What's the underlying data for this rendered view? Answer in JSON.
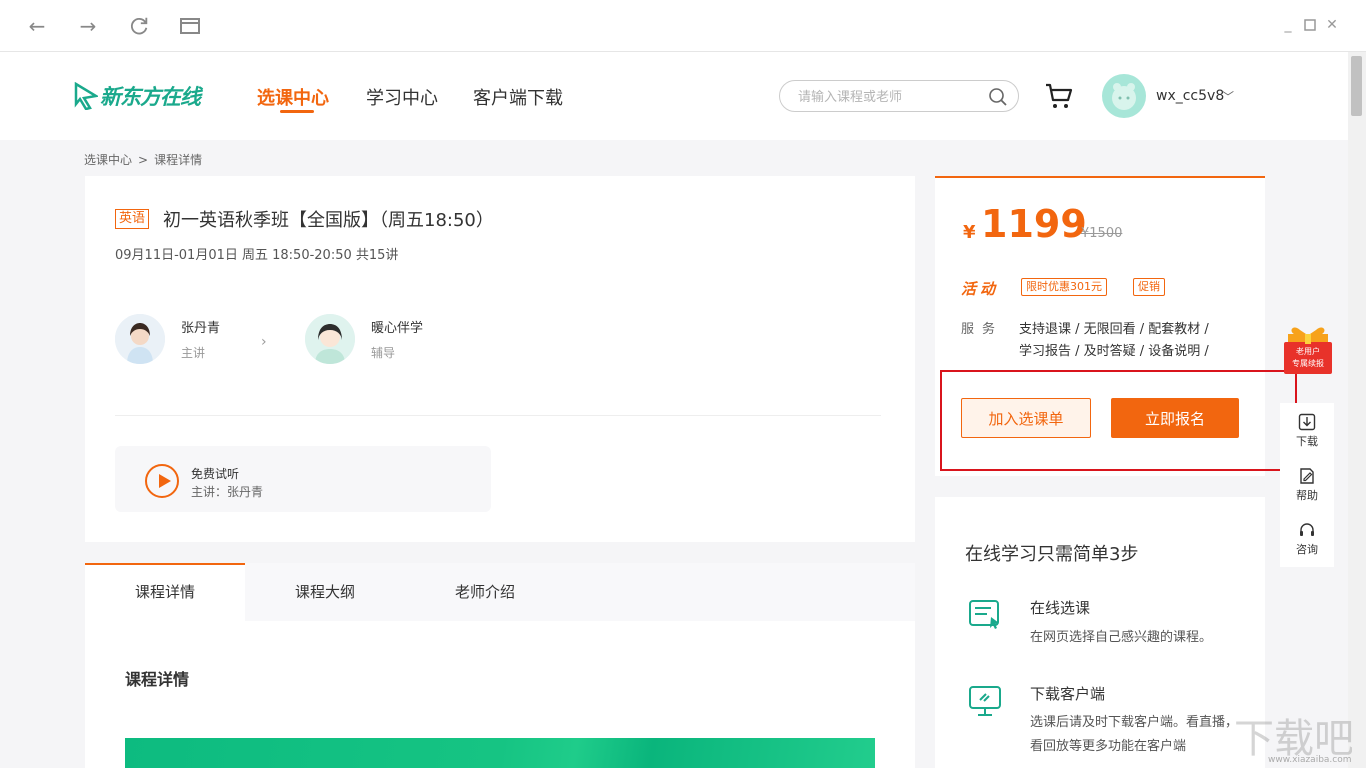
{
  "header": {
    "logo_text": "新东方在线",
    "nav": [
      "选课中心",
      "学习中心",
      "客户端下载"
    ],
    "search_placeholder": "请输入课程或老师",
    "username": "wx_cc5v8"
  },
  "breadcrumb": [
    "选课中心",
    ">",
    "课程详情"
  ],
  "course": {
    "tag": "英语",
    "title": "初一英语秋季班【全国版】（周五18:50）",
    "time": "09月11日-01月01日 周五 18:50-20:50 共15讲",
    "teachers": [
      {
        "name": "张丹青",
        "role": "主讲"
      },
      {
        "name": "暖心伴学",
        "role": "辅导"
      }
    ],
    "trial_title": "免费试听",
    "trial_sub": "主讲：张丹青"
  },
  "tabs": [
    "课程详情",
    "课程大纲",
    "老师介绍"
  ],
  "detail_heading": "课程详情",
  "pricing": {
    "currency": "¥",
    "price": "1199",
    "old_price": "¥1500",
    "activity_label": "活动",
    "badges": [
      "限时优惠301元",
      "促销"
    ],
    "service_label": "服务",
    "service_lines": [
      "支持退课 / 无限回看 / 配套教材 /",
      "学习报告 / 及时答疑 / 设备说明 /"
    ],
    "add_button": "加入选课单",
    "buy_button": "立即报名"
  },
  "steps": {
    "title": "在线学习只需简单3步",
    "items": [
      {
        "title": "在线选课",
        "desc": "在网页选择自己感兴趣的课程。"
      },
      {
        "title": "下载客户端",
        "desc": "选课后请及时下载客户端。看直播，看回放等更多功能在客户端"
      }
    ]
  },
  "side_toolbar": {
    "gift_line1": "老用户",
    "gift_line2": "专属续报",
    "items": [
      "下载",
      "帮助",
      "咨询"
    ]
  },
  "watermark": {
    "text": "下载吧",
    "sub": "www.xiazaiba.com"
  },
  "colors": {
    "accent": "#f2660f",
    "brand": "#1aa98c",
    "highlight": "#d9141c"
  }
}
